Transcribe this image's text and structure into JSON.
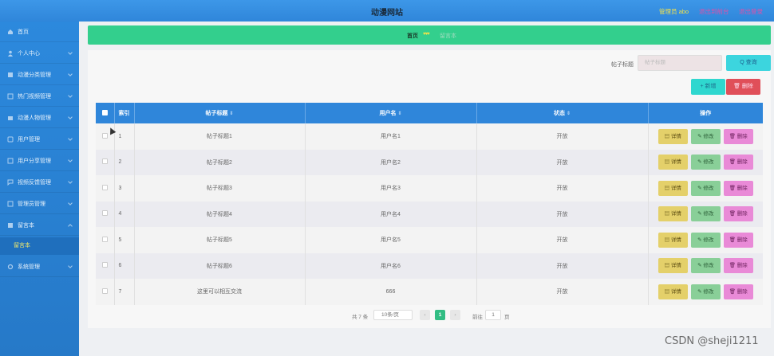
{
  "header": {
    "title": "动漫网站",
    "admin_label": "管理员 abo",
    "back_label": "退出到前台",
    "logout_label": "退出登录"
  },
  "sidebar": {
    "items": [
      {
        "label": "首页",
        "icon": "home-icon"
      },
      {
        "label": "个人中心",
        "icon": "user-icon"
      },
      {
        "label": "动漫分类管理",
        "icon": "category-icon"
      },
      {
        "label": "热门视频管理",
        "icon": "video-icon"
      },
      {
        "label": "动漫人物管理",
        "icon": "character-icon"
      },
      {
        "label": "用户管理",
        "icon": "users-icon"
      },
      {
        "label": "用户分享管理",
        "icon": "share-icon"
      },
      {
        "label": "视频反馈管理",
        "icon": "feedback-icon"
      },
      {
        "label": "管理员管理",
        "icon": "admin-icon"
      },
      {
        "label": "留言本",
        "icon": "message-icon"
      },
      {
        "label": "系统管理",
        "icon": "settings-icon"
      }
    ],
    "sub_item": "留言本"
  },
  "breadcrumb": {
    "home": "首页",
    "hearts": "♥♥♥",
    "current": "留言本"
  },
  "search": {
    "label": "帖子标题",
    "placeholder": "帖子标题",
    "query_label": "Q 查询"
  },
  "toolbar": {
    "add_label": "+ 新增",
    "delete_label": "🗑 删除"
  },
  "table": {
    "headers": [
      "索引",
      "帖子标题",
      "用户名",
      "状态",
      "操作"
    ],
    "rows": [
      {
        "index": "1",
        "title": "帖子标题1",
        "user": "用户名1",
        "status": "开放"
      },
      {
        "index": "2",
        "title": "帖子标题2",
        "user": "用户名2",
        "status": "开放"
      },
      {
        "index": "3",
        "title": "帖子标题3",
        "user": "用户名3",
        "status": "开放"
      },
      {
        "index": "4",
        "title": "帖子标题4",
        "user": "用户名4",
        "status": "开放"
      },
      {
        "index": "5",
        "title": "帖子标题5",
        "user": "用户名5",
        "status": "开放"
      },
      {
        "index": "6",
        "title": "帖子标题6",
        "user": "用户名6",
        "status": "开放"
      },
      {
        "index": "7",
        "title": "这里可以相互交流",
        "user": "666",
        "status": "开放"
      }
    ],
    "actions": {
      "detail": "详情",
      "edit": "修改",
      "delete": "删除"
    }
  },
  "pagination": {
    "total": "共 7 条",
    "page_size": "10条/页",
    "prev": "‹",
    "current": "1",
    "next": "›",
    "goto_label": "前往",
    "goto_value": "1",
    "unit": "页"
  },
  "watermark": "CSDN @sheji1211",
  "colors": {
    "header": "#2f86da",
    "sidebar": "#2679c8",
    "breadcrumb": "#33cf8d",
    "table_header": "#2f86da",
    "detail_btn": "#e4d06a",
    "edit_btn": "#89cf98",
    "delete_btn": "#e98ad7"
  }
}
